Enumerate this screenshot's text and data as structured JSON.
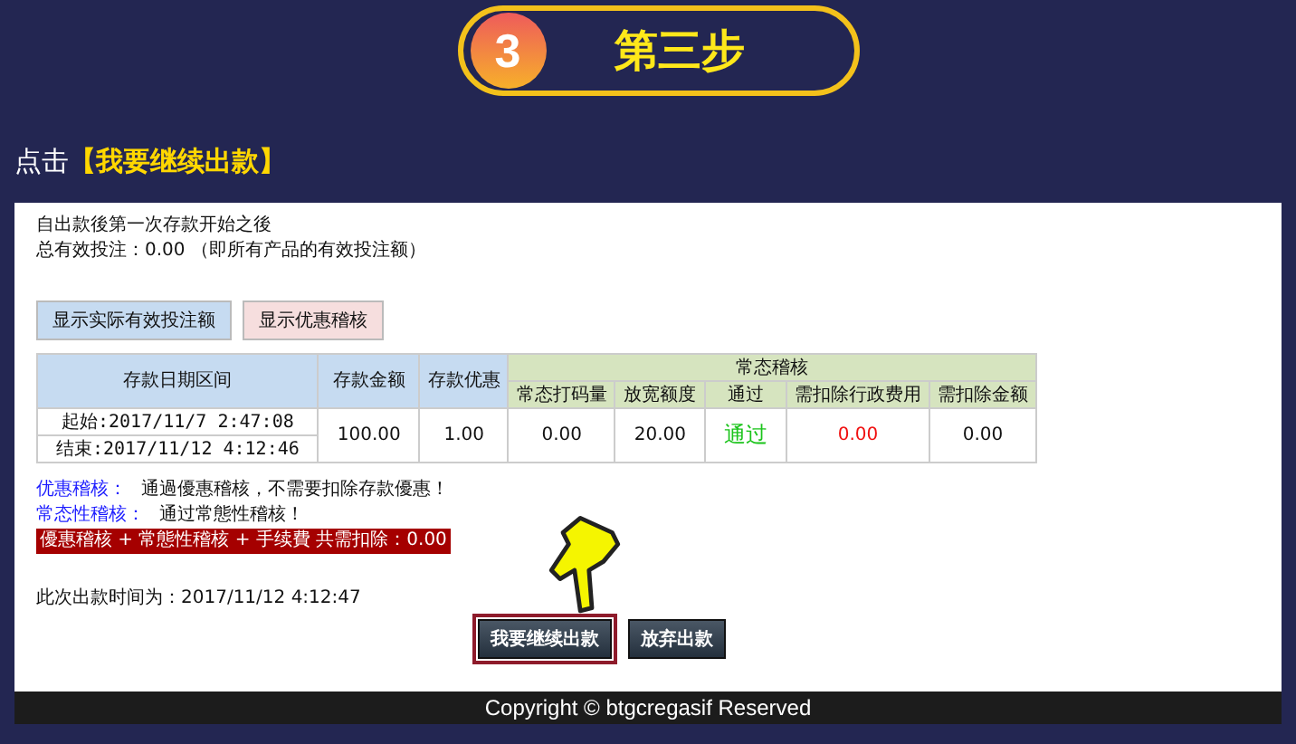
{
  "step": {
    "number": "3",
    "title": "第三步"
  },
  "instruction": {
    "prefix": "点击",
    "highlight": "【我要继续出款】"
  },
  "intro": [
    "自出款後第一次存款开始之後",
    "总有效投注：0.00 （即所有产品的有效投注额）"
  ],
  "toggle_buttons": [
    {
      "label": "显示实际有效投注额",
      "color": "#c6dbf1"
    },
    {
      "label": "显示优惠稽核",
      "color": "#f6dede"
    }
  ],
  "table": {
    "group_header": "常态稽核",
    "columns": [
      "存款日期区间",
      "存款金额",
      "存款优惠",
      "常态打码量",
      "放宽额度",
      "通过",
      "需扣除行政费用",
      "需扣除金额"
    ],
    "start": "起始:2017/11/7 2:47:08",
    "end": "结束:2017/11/12 4:12:46",
    "cells": [
      {
        "text": "100.00",
        "kind": "normal"
      },
      {
        "text": "1.00",
        "kind": "normal"
      },
      {
        "text": "0.00",
        "kind": "normal"
      },
      {
        "text": "20.00",
        "kind": "normal"
      },
      {
        "text": "通过",
        "kind": "pass"
      },
      {
        "text": "0.00",
        "kind": "fee"
      },
      {
        "text": "0.00",
        "kind": "normal"
      }
    ]
  },
  "audits": [
    {
      "label": "优惠稽核：",
      "text": "通過優惠稽核，不需要扣除存款優惠！"
    },
    {
      "label": "常态性稽核：",
      "text": "通过常態性稽核！"
    }
  ],
  "total_banner": "優惠稽核 + 常態性稽核 + 手续費 共需扣除：0.00",
  "withdraw_time": "此次出款时间为：2017/11/12 4:12:47",
  "buttons": [
    {
      "label": "我要继续出款",
      "highlighted": true
    },
    {
      "label": "放弃出款",
      "highlighted": false
    }
  ],
  "footer": "Copyright © btgcregasif Reserved"
}
